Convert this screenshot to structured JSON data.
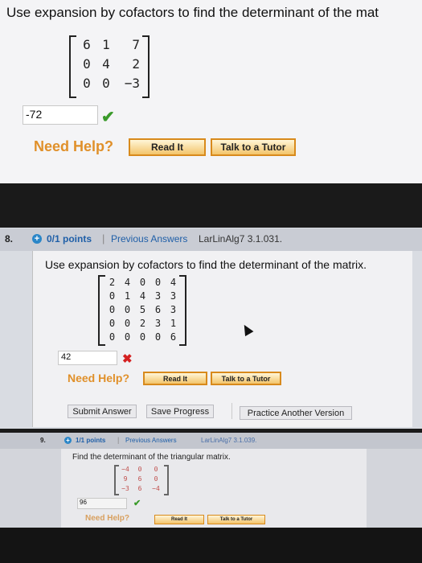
{
  "q7": {
    "prompt": "Use expansion by cofactors to find the determinant of the mat",
    "matrix": [
      [
        "6",
        "1",
        "7"
      ],
      [
        "0",
        "4",
        "2"
      ],
      [
        "0",
        "0",
        "−3"
      ]
    ],
    "answer": "-72",
    "need_help": "Need Help?",
    "read_it": "Read It",
    "talk_tutor": "Talk to a Tutor"
  },
  "q8": {
    "number": "8.",
    "points": "0/1 points",
    "separator": "|",
    "previous_answers": "Previous Answers",
    "reference": "LarLinAlg7 3.1.031.",
    "prompt": "Use expansion by cofactors to find the determinant of the matrix.",
    "matrix": [
      [
        "2",
        "4",
        "0",
        "0",
        "4"
      ],
      [
        "0",
        "1",
        "4",
        "3",
        "3"
      ],
      [
        "0",
        "0",
        "5",
        "6",
        "3"
      ],
      [
        "0",
        "0",
        "2",
        "3",
        "1"
      ],
      [
        "0",
        "0",
        "0",
        "0",
        "6"
      ]
    ],
    "answer": "42",
    "need_help": "Need Help?",
    "read_it": "Read It",
    "talk_tutor": "Talk to a Tutor",
    "submit": "Submit Answer",
    "save": "Save Progress",
    "practice": "Practice Another Version"
  },
  "q9": {
    "number": "9.",
    "points": "1/1 points",
    "separator": "|",
    "previous_answers": "Previous Answers",
    "reference": "LarLinAlg7 3.1.039.",
    "prompt": "Find the determinant of the triangular matrix.",
    "matrix": [
      [
        "−4",
        "0",
        "0"
      ],
      [
        "9",
        "6",
        "0"
      ],
      [
        "−3",
        "6",
        "−4"
      ]
    ],
    "answer": "96",
    "need_help": "Need Help?",
    "read_it": "Read It",
    "talk_tutor": "Talk to a Tutor"
  },
  "colors": {
    "accent": "#1f5fa8",
    "correct": "#3a9a2a",
    "wrong": "#d42020",
    "help": "#e0902a"
  },
  "icons": {
    "correct": "check-icon",
    "wrong": "x-icon",
    "points": "plus-circle-icon",
    "pointer": "mouse-cursor-icon"
  }
}
